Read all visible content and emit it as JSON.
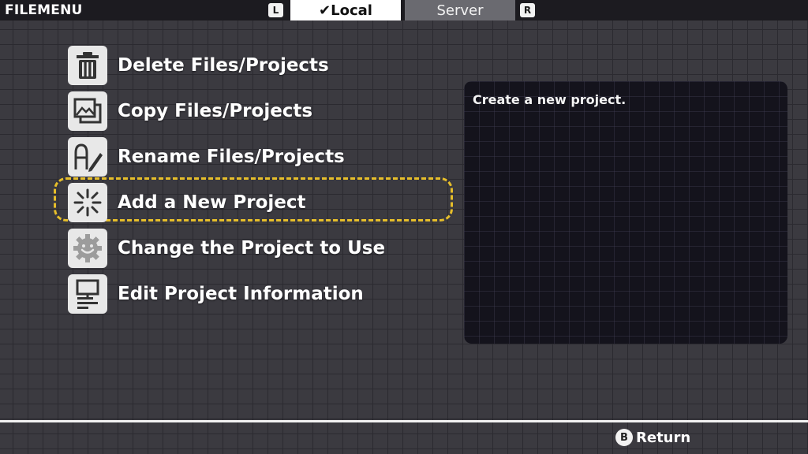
{
  "header": {
    "title": "FILEMENU",
    "left_button": "L",
    "right_button": "R",
    "tabs": [
      {
        "label": "✔Local",
        "selected": true
      },
      {
        "label": "Server",
        "selected": false
      }
    ]
  },
  "menu": {
    "items": [
      {
        "label": "Delete Files/Projects",
        "icon": "trash-icon"
      },
      {
        "label": "Copy Files/Projects",
        "icon": "copy-images-icon"
      },
      {
        "label": "Rename Files/Projects",
        "icon": "rename-pen-icon"
      },
      {
        "label": "Add a New Project",
        "icon": "sparkle-new-icon",
        "selected": true
      },
      {
        "label": "Change the Project to Use",
        "icon": "gear-smile-icon"
      },
      {
        "label": "Edit Project Information",
        "icon": "monitor-document-icon"
      }
    ]
  },
  "description": {
    "text": "Create a new project."
  },
  "footer": {
    "button": "B",
    "label": "Return"
  },
  "colors": {
    "background": "#3b3a40",
    "grid_line": "#2b2a30",
    "selection": "#e6be2a",
    "panel": "#14131c",
    "tab_active": "#ffffff",
    "tab_inactive": "#6a6a70"
  }
}
